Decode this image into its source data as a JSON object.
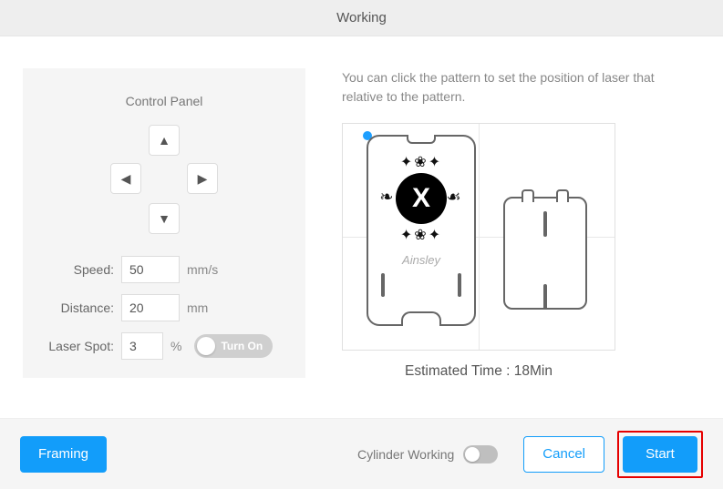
{
  "header": {
    "title": "Working"
  },
  "control": {
    "title": "Control Panel",
    "speed": {
      "label": "Speed:",
      "value": "50",
      "unit": "mm/s"
    },
    "distance": {
      "label": "Distance:",
      "value": "20",
      "unit": "mm"
    },
    "laserSpot": {
      "label": "Laser Spot:",
      "value": "3",
      "unit": "%",
      "toggleLabel": "Turn On"
    }
  },
  "preview": {
    "instructions": "You can click the pattern to set the position of laser that relative to the pattern.",
    "badgeLetter": "X",
    "caption": "Ainsley",
    "estimatedLabel": "Estimated Time : 18Min"
  },
  "footer": {
    "framing": "Framing",
    "cylinderLabel": "Cylinder Working",
    "cancel": "Cancel",
    "start": "Start"
  }
}
